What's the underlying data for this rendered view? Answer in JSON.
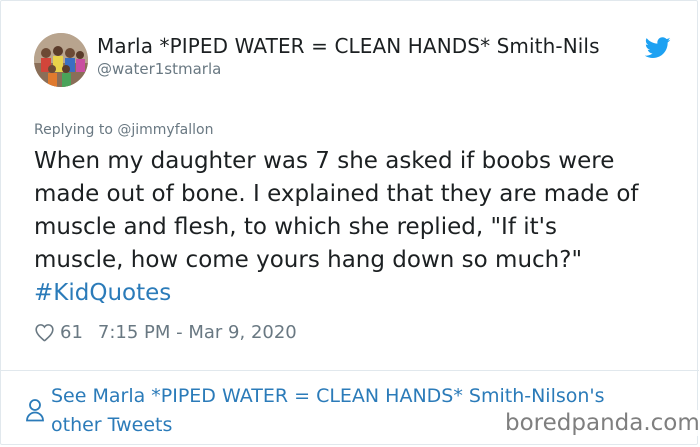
{
  "user": {
    "display_name": "Marla *PIPED WATER = CLEAN HANDS* Smith-Nils",
    "handle": "@water1stmarla"
  },
  "icons": {
    "platform": "twitter-bird-icon",
    "like": "heart-icon",
    "profile": "person-icon"
  },
  "tweet": {
    "replying_to": "Replying to @jimmyfallon",
    "lines": [
      "When my daughter was 7 she asked if boobs were",
      "made out of bone. I explained that they are made of",
      "muscle and flesh, to which she replied, \"If it's",
      "muscle, how come yours hang down so much?\""
    ],
    "hashtag": "#KidQuotes",
    "likes": "61",
    "timestamp": "7:15 PM - Mar 9, 2020"
  },
  "footer": {
    "see_more_line1": "See Marla *PIPED WATER = CLEAN HANDS* Smith-Nilson's",
    "see_more_line2": "other Tweets"
  },
  "watermark": "boredpanda.com",
  "colors": {
    "link": "#2b7bb9",
    "twitter_blue": "#1da1f2",
    "muted": "#697882",
    "text": "#1c2022",
    "border": "#e1e8ed"
  }
}
